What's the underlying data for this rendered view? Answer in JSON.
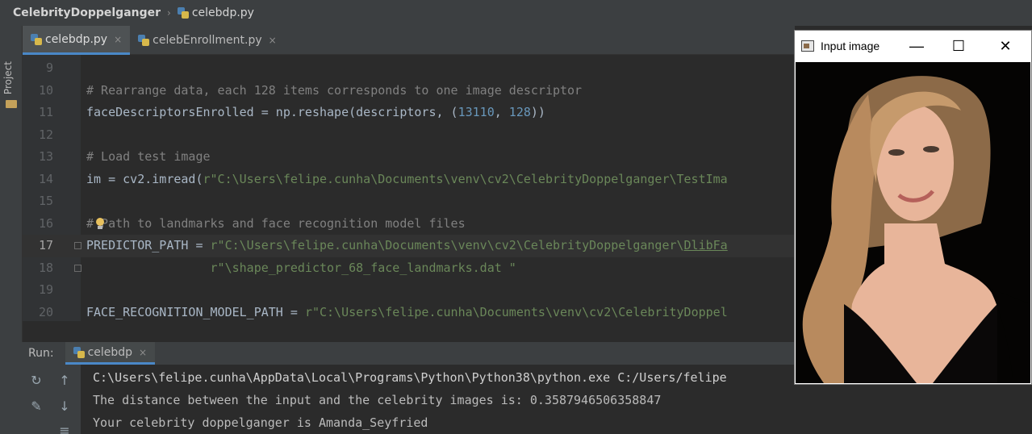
{
  "navbar": {
    "project": "CelebrityDoppelganger",
    "file": "celebdp.py"
  },
  "toolstrip": {
    "project_label": "Project"
  },
  "tabs": [
    {
      "label": "celebdp.py",
      "close": "×"
    },
    {
      "label": "celebEnrollment.py",
      "close": "×"
    }
  ],
  "editor": {
    "lines": [
      {
        "num": "9",
        "parts": []
      },
      {
        "num": "10",
        "parts": [
          {
            "t": "# Rearrange data, each 128 items corresponds to one image descriptor",
            "c": "c-comment"
          }
        ]
      },
      {
        "num": "11",
        "parts": [
          {
            "t": "faceDescriptorsEnrolled = np.reshape(descriptors, (",
            "c": ""
          },
          {
            "t": "13110",
            "c": "c-num"
          },
          {
            "t": ", ",
            "c": ""
          },
          {
            "t": "128",
            "c": "c-num"
          },
          {
            "t": "))",
            "c": ""
          }
        ]
      },
      {
        "num": "12",
        "parts": []
      },
      {
        "num": "13",
        "parts": [
          {
            "t": "# Load test image",
            "c": "c-comment"
          }
        ]
      },
      {
        "num": "14",
        "parts": [
          {
            "t": "im = cv2.imread(",
            "c": ""
          },
          {
            "t": "r\"C:\\Users\\felipe.cunha\\Documents\\venv\\cv2\\CelebrityDoppelganger\\TestIma",
            "c": "c-string"
          }
        ]
      },
      {
        "num": "15",
        "parts": []
      },
      {
        "num": "16",
        "parts": [
          {
            "t": "# Path to landmarks and face recognition model files",
            "c": "c-comment"
          }
        ]
      },
      {
        "num": "17",
        "parts": [
          {
            "t": "PREDICTOR_PATH = ",
            "c": ""
          },
          {
            "t": "r\"C:\\Users\\felipe.cunha\\Documents\\venv\\cv2\\CelebrityDoppelganger\\",
            "c": "c-string"
          },
          {
            "t": "DlibFa",
            "c": "c-ulstr"
          }
        ]
      },
      {
        "num": "18",
        "parts": [
          {
            "t": "                 r\"\\shape_predictor_68_face_landmarks.dat \"",
            "c": "c-string"
          }
        ]
      },
      {
        "num": "19",
        "parts": []
      },
      {
        "num": "20",
        "parts": [
          {
            "t": "FACE_RECOGNITION_MODEL_PATH = ",
            "c": ""
          },
          {
            "t": "r\"C:\\Users\\felipe.cunha\\Documents\\venv\\cv2\\CelebrityDoppel",
            "c": "c-string"
          }
        ]
      }
    ]
  },
  "run": {
    "label": "Run:",
    "tab": "celebdp",
    "close": "×",
    "output": [
      "C:\\Users\\felipe.cunha\\AppData\\Local\\Programs\\Python\\Python38\\python.exe C:/Users/felipe",
      "The distance between the input and the celebrity images is: 0.3587946506358847",
      "Your celebrity doppelganger is Amanda_Seyfried"
    ]
  },
  "image_window": {
    "title": "Input image",
    "minimize": "—",
    "maximize": "☐",
    "close": "✕",
    "colors": {
      "background": "#050403",
      "hair": "#b88a5e",
      "skin": "#e8b59a",
      "dress": "#0a0808"
    }
  }
}
